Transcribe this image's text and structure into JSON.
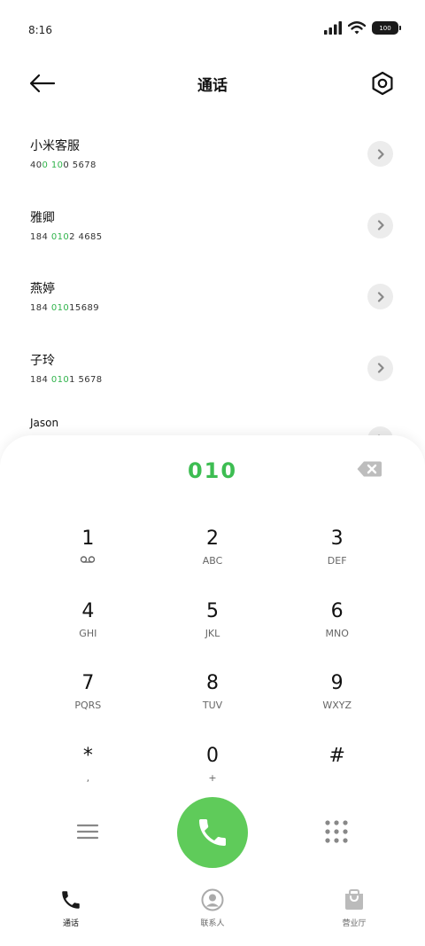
{
  "status": {
    "time": "8:16",
    "battery": "100"
  },
  "header": {
    "title": "通话"
  },
  "contacts": [
    {
      "name": "小米客服",
      "num_pre": "40",
      "num_hl": "0 10",
      "num_post": "0 5678"
    },
    {
      "name": "雅卿",
      "num_pre": "184 ",
      "num_hl": "010",
      "num_post": "2 4685"
    },
    {
      "name": "燕婷",
      "num_pre": "184 ",
      "num_hl": "010",
      "num_post": "15689"
    },
    {
      "name": "子玲",
      "num_pre": "184 ",
      "num_hl": "010",
      "num_post": "1 5678"
    },
    {
      "name": "Jason",
      "num_pre": "",
      "num_hl": "",
      "num_post": ""
    }
  ],
  "dialer": {
    "input": "010"
  },
  "keys": [
    {
      "digit": "1",
      "sub": ""
    },
    {
      "digit": "2",
      "sub": "ABC"
    },
    {
      "digit": "3",
      "sub": "DEF"
    },
    {
      "digit": "4",
      "sub": "GHI"
    },
    {
      "digit": "5",
      "sub": "JKL"
    },
    {
      "digit": "6",
      "sub": "MNO"
    },
    {
      "digit": "7",
      "sub": "PQRS"
    },
    {
      "digit": "8",
      "sub": "TUV"
    },
    {
      "digit": "9",
      "sub": "WXYZ"
    },
    {
      "digit": "*",
      "sub": ","
    },
    {
      "digit": "0",
      "sub": "+"
    },
    {
      "digit": "#",
      "sub": ""
    }
  ],
  "nav": [
    {
      "label": "通话",
      "icon": "phone-icon"
    },
    {
      "label": "联系人",
      "icon": "contact-icon"
    },
    {
      "label": "营业厅",
      "icon": "shopping-bag-icon"
    }
  ],
  "colors": {
    "accent": "#3dbd52",
    "call_button": "#5fcb5a",
    "highlight": "#2fb34a"
  }
}
